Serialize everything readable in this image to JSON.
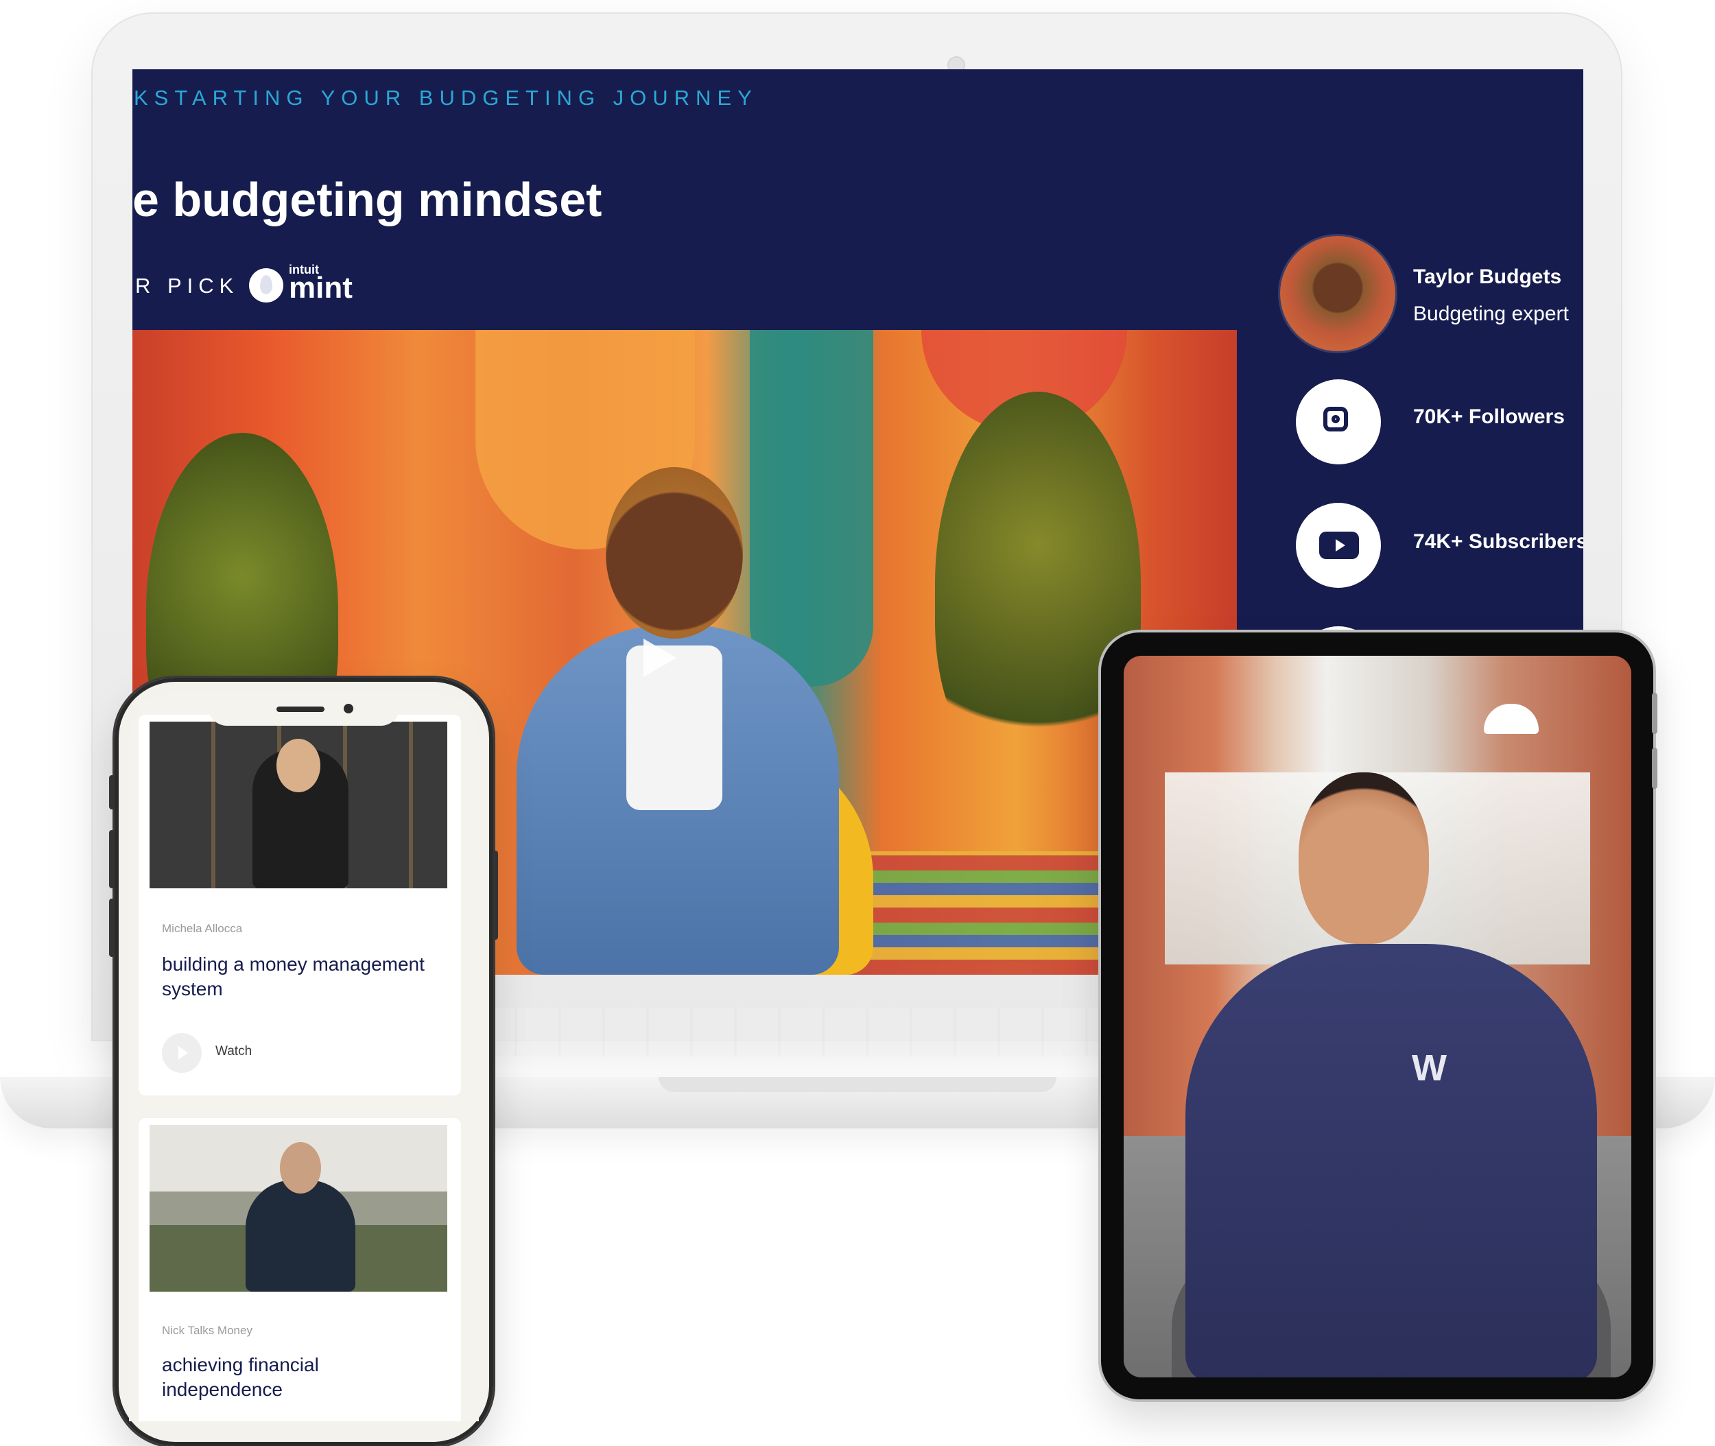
{
  "laptop": {
    "kicker": "KSTARTING YOUR BUDGETING JOURNEY",
    "headline": "e budgeting mindset",
    "pick_label": "R PICK",
    "sponsor_logo": {
      "intuit": "intuit",
      "word": "mint"
    },
    "hero_video": {
      "play_icon": "play-icon"
    },
    "profile": {
      "name": "Taylor Budgets",
      "role": "Budgeting expert"
    },
    "social": [
      {
        "icon": "instagram-icon",
        "count": "70K+ Followers"
      },
      {
        "icon": "youtube-icon",
        "count": "74K+ Subscribers"
      }
    ]
  },
  "phone": {
    "cards": [
      {
        "author": "Michela Allocca",
        "title": "building a money management system",
        "action_label": "Watch"
      },
      {
        "author": "Nick Talks Money",
        "title": "achieving financial independence"
      }
    ]
  },
  "tablet": {
    "shirt_logo": "W"
  },
  "colors": {
    "navy": "#161c4e",
    "kicker_blue": "#2ba7d6",
    "white": "#ffffff"
  }
}
